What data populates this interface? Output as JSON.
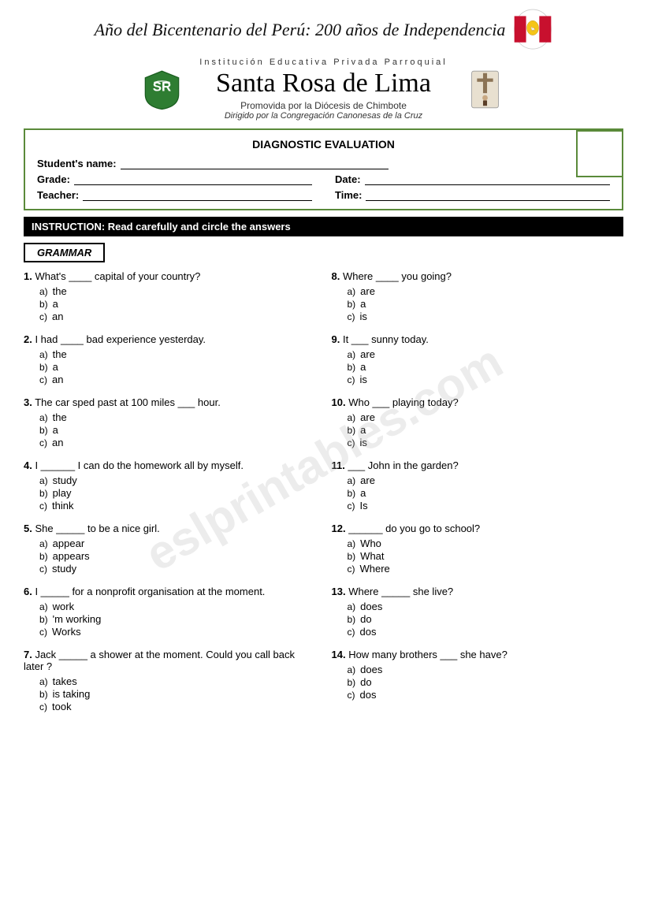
{
  "header": {
    "banner_text": "Año del Bicentenario del Perú: 200 años de Independencia",
    "institution_label": "Institución Educativa Privada Parroquial",
    "school_name": "Santa Rosa de Lima",
    "sub1": "Promovida por la Diócesis de Chimbote",
    "sub2": "Dirigido por la Congregación Canonesas de la Cruz"
  },
  "form": {
    "title": "DIAGNOSTIC EVALUATION",
    "student_label": "Student's name:",
    "grade_label": "Grade:",
    "date_label": "Date:",
    "teacher_label": "Teacher:",
    "time_label": "Time:"
  },
  "instruction": {
    "text": "INSTRUCTION: Read carefully and circle the answers"
  },
  "grammar_section": {
    "label": "GRAMMAR"
  },
  "left_questions": [
    {
      "number": "1.",
      "text": "What's ____ capital of your country?",
      "options": [
        {
          "label": "a)",
          "text": "the"
        },
        {
          "label": "b)",
          "text": "a"
        },
        {
          "label": "c)",
          "text": "an"
        }
      ]
    },
    {
      "number": "2.",
      "text": "I had ____ bad experience yesterday.",
      "options": [
        {
          "label": "a)",
          "text": "the"
        },
        {
          "label": "b)",
          "text": "a"
        },
        {
          "label": "c)",
          "text": "an"
        }
      ]
    },
    {
      "number": "3.",
      "text": "The car sped past at 100 miles ___ hour.",
      "options": [
        {
          "label": "a)",
          "text": "the"
        },
        {
          "label": "b)",
          "text": "a"
        },
        {
          "label": "c)",
          "text": "an"
        }
      ]
    },
    {
      "number": "4.",
      "text": "I ______ I can do the homework all by myself.",
      "options": [
        {
          "label": "a)",
          "text": "study"
        },
        {
          "label": "b)",
          "text": "play"
        },
        {
          "label": "c)",
          "text": "think"
        }
      ]
    },
    {
      "number": "5.",
      "text": "She _____ to be a nice girl.",
      "options": [
        {
          "label": "a)",
          "text": "appear"
        },
        {
          "label": "b)",
          "text": "appears"
        },
        {
          "label": "c)",
          "text": "study"
        }
      ]
    },
    {
      "number": "6.",
      "text": "I _____ for a nonprofit organisation at the moment.",
      "options": [
        {
          "label": "a)",
          "text": "work"
        },
        {
          "label": "b)",
          "text": "'m working"
        },
        {
          "label": "c)",
          "text": "Works"
        }
      ]
    },
    {
      "number": "7.",
      "text": "Jack _____ a shower at the moment. Could you call back later ?",
      "options": [
        {
          "label": "a)",
          "text": "takes"
        },
        {
          "label": "b)",
          "text": "is taking"
        },
        {
          "label": "c)",
          "text": "took"
        }
      ]
    }
  ],
  "right_questions": [
    {
      "number": "8.",
      "text": "Where ____ you going?",
      "options": [
        {
          "label": "a)",
          "text": "are"
        },
        {
          "label": "b)",
          "text": "a"
        },
        {
          "label": "c)",
          "text": "is"
        }
      ]
    },
    {
      "number": "9.",
      "text": "It ___ sunny today.",
      "options": [
        {
          "label": "a)",
          "text": "are"
        },
        {
          "label": "b)",
          "text": "a"
        },
        {
          "label": "c)",
          "text": "is"
        }
      ]
    },
    {
      "number": "10.",
      "text": "Who ___ playing today?",
      "options": [
        {
          "label": "a)",
          "text": "are"
        },
        {
          "label": "b)",
          "text": "a"
        },
        {
          "label": "c)",
          "text": "is"
        }
      ]
    },
    {
      "number": "11.",
      "text": "___ John in the garden?",
      "options": [
        {
          "label": "a)",
          "text": "are"
        },
        {
          "label": "b)",
          "text": "a"
        },
        {
          "label": "c)",
          "text": "Is"
        }
      ]
    },
    {
      "number": "12.",
      "text": "______ do you go to school?",
      "options": [
        {
          "label": "a)",
          "text": "Who"
        },
        {
          "label": "b)",
          "text": "What"
        },
        {
          "label": "c)",
          "text": "Where"
        }
      ]
    },
    {
      "number": "13.",
      "text": "Where _____ she live?",
      "options": [
        {
          "label": "a)",
          "text": "does"
        },
        {
          "label": "b)",
          "text": "do"
        },
        {
          "label": "c)",
          "text": "dos"
        }
      ]
    },
    {
      "number": "14.",
      "text": "How many brothers ___ she have?",
      "options": [
        {
          "label": "a)",
          "text": "does"
        },
        {
          "label": "b)",
          "text": "do"
        },
        {
          "label": "c)",
          "text": "dos"
        }
      ]
    }
  ],
  "watermark": "eslprintables.com"
}
